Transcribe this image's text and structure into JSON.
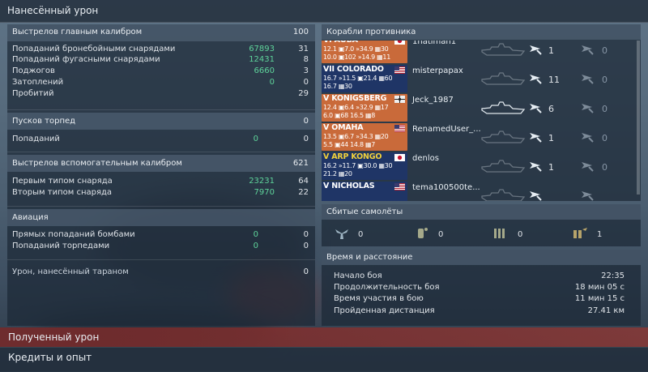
{
  "header": {
    "title": "Нанесённый урон"
  },
  "left": {
    "main_battery": {
      "title": "Выстрелов главным калибром",
      "total": "100",
      "rows": [
        {
          "label": "Попаданий бронебойными снарядами",
          "damage": "67893",
          "count": "31"
        },
        {
          "label": "Попаданий фугасными снарядами",
          "damage": "12431",
          "count": "8"
        },
        {
          "label": "Поджогов",
          "damage": "6660",
          "count": "3"
        },
        {
          "label": "Затоплений",
          "damage": "0",
          "count": "0"
        },
        {
          "label": "Пробитий",
          "damage": "",
          "count": "29"
        }
      ]
    },
    "torpedoes": {
      "title": "Пусков торпед",
      "total": "0",
      "rows": [
        {
          "label": "Попаданий",
          "damage": "0",
          "count": "0"
        }
      ]
    },
    "secondary": {
      "title": "Выстрелов вспомогательным калибром",
      "total": "621",
      "rows": [
        {
          "label": "Первым типом снаряда",
          "damage": "23231",
          "count": "64"
        },
        {
          "label": "Вторым типом снаряда",
          "damage": "7970",
          "count": "22"
        }
      ]
    },
    "aviation": {
      "title": "Авиация",
      "rows": [
        {
          "label": "Прямых попаданий бомбами",
          "damage": "0",
          "count": "0"
        },
        {
          "label": "Попаданий торпедами",
          "damage": "0",
          "count": "0"
        }
      ]
    },
    "ram": {
      "title": "Урон, нанесённый тараном",
      "total": "0"
    }
  },
  "right": {
    "enemies_title": "Корабли противника",
    "ships": [
      {
        "name": "VI AOBA",
        "line1": "12.1 ▣7.0  »34.9 ▦30",
        "line2": "10.0 ▣102  »14.9 ▦11",
        "color": "#c96a3a",
        "name_color": "#ffffff",
        "flag": "jp",
        "player": "1hatiman1",
        "n1": "1",
        "n2": "0"
      },
      {
        "name": "VII COLORADO",
        "line1": "16.7 »11.5  ▣21.4 ▦60",
        "line2": "            16.7 ▦30",
        "color": "#1f3566",
        "name_color": "#ffffff",
        "flag": "us",
        "player": "misterpapax",
        "n1": "11",
        "n2": "0"
      },
      {
        "name": "V KONIGSBERG",
        "line1": "12.4 ▣6.4  »32.9 ▦17",
        "line2": "6.0 ▣68  16.5 ▦8",
        "color": "#c96a3a",
        "name_color": "#ffffff",
        "flag": "de",
        "player": "Jeck_1987",
        "n1": "6",
        "n2": "0"
      },
      {
        "name": "V OMAHA",
        "line1": "13.5 ▣6.7  »34.3 ▦20",
        "line2": "5.5 ▣44  14.8 ▦7",
        "color": "#c96a3a",
        "name_color": "#ffffff",
        "flag": "us",
        "player": "RenamedUser_...",
        "n1": "1",
        "n2": "0"
      },
      {
        "name": "V ARP KONGO",
        "line1": "16.2 »11.7  ▣30.0 ▦30",
        "line2": "            21.2 ▦20",
        "color": "#1f3566",
        "name_color": "#f2d13a",
        "flag": "jp",
        "player": "denlos",
        "n1": "1",
        "n2": "0"
      },
      {
        "name": "V NICHOLAS",
        "line1": "",
        "line2": "",
        "color": "#1f3566",
        "name_color": "#ffffff",
        "flag": "us",
        "player": "tema100500te...",
        "n1": "",
        "n2": ""
      }
    ],
    "aircraft": {
      "title": "Сбитые самолёты",
      "items": [
        {
          "icon": "fighter-icon",
          "value": "0"
        },
        {
          "icon": "torpedo-bomber-icon",
          "value": "0"
        },
        {
          "icon": "dive-bomber-icon",
          "value": "0"
        },
        {
          "icon": "spotter-icon",
          "value": "1"
        }
      ]
    },
    "time": {
      "title": "Время и расстояние",
      "rows": [
        {
          "label": "Начало боя",
          "value": "22:35"
        },
        {
          "label": "Продолжительность боя",
          "value": "18 мин 05 с"
        },
        {
          "label": "Время участия в бою",
          "value": "11 мин 15 с"
        },
        {
          "label": "Пройденная дистанция",
          "value": "27.41 км"
        }
      ]
    }
  },
  "footer": {
    "received": "Полученный урон",
    "credits": "Кредиты и опыт"
  }
}
